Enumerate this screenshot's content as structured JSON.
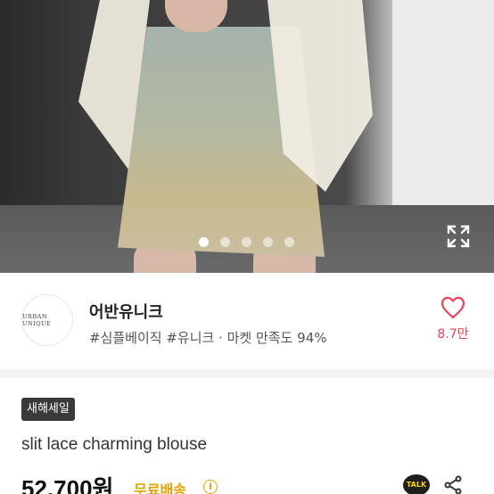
{
  "gallery": {
    "image_count": 5,
    "active_index": 0,
    "expand_icon": "expand-icon"
  },
  "seller": {
    "logo_text": "URBAN UNIQUE",
    "name": "어반유니크",
    "tags": "#심플베이직 #유니크 · 마켓 만족도 94%",
    "like_icon": "heart-outline-icon",
    "like_count": "8.7만",
    "accent_color": "#e8445a"
  },
  "product": {
    "badge": "새해세일",
    "title": "slit lace charming blouse",
    "price": "52,700원",
    "shipping": "무료배송",
    "info_icon": "i",
    "talk_label": "TALK",
    "share_icon": "share-icon",
    "shipping_color": "#e2a100"
  }
}
